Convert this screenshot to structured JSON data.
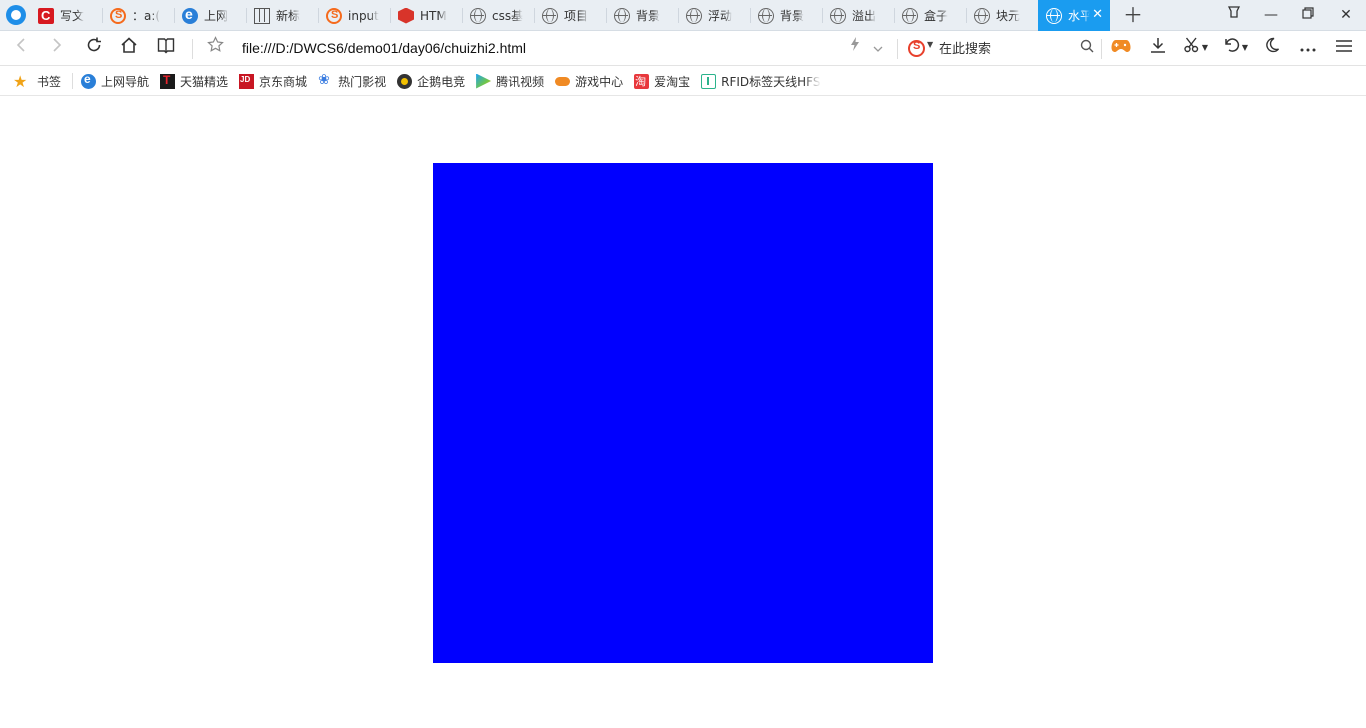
{
  "tabs": [
    {
      "label": "写文",
      "icon": "csdn-icon"
    },
    {
      "label": "：a:(",
      "icon": "sogou-icon"
    },
    {
      "label": "上网",
      "icon": "ie-icon"
    },
    {
      "label": "新标",
      "icon": "grid-icon"
    },
    {
      "label": "input",
      "icon": "sogou-icon"
    },
    {
      "label": "HTM",
      "icon": "html5-icon"
    },
    {
      "label": "css基",
      "icon": "globe-icon"
    },
    {
      "label": "项目",
      "icon": "globe-icon"
    },
    {
      "label": "背景",
      "icon": "globe-icon"
    },
    {
      "label": "浮动",
      "icon": "globe-icon"
    },
    {
      "label": "背景",
      "icon": "globe-icon"
    },
    {
      "label": "溢出",
      "icon": "globe-icon"
    },
    {
      "label": "盒子",
      "icon": "globe-icon"
    },
    {
      "label": "块元",
      "icon": "globe-icon"
    },
    {
      "label": "水平",
      "icon": "globe-icon",
      "active": true
    }
  ],
  "address": {
    "url": "file:///D:/DWCS6/demo01/day06/chuizhi2.html"
  },
  "search": {
    "placeholder": "在此搜索"
  },
  "bookmarks": {
    "folder_label": "书签",
    "items": [
      {
        "label": "上网导航",
        "icon": "ie-icon"
      },
      {
        "label": "天猫精选",
        "icon": "tmall-icon"
      },
      {
        "label": "京东商城",
        "icon": "jd-icon"
      },
      {
        "label": "热门影视",
        "icon": "paw-icon"
      },
      {
        "label": "企鹅电竞",
        "icon": "esports-icon"
      },
      {
        "label": "腾讯视频",
        "icon": "tencent-video-icon"
      },
      {
        "label": "游戏中心",
        "icon": "gamepad-icon"
      },
      {
        "label": "爱淘宝",
        "icon": "taobao-icon"
      },
      {
        "label": "RFID标签天线HFS",
        "icon": "book-icon"
      }
    ]
  },
  "content": {
    "box_color": "#0000ff"
  },
  "colors": {
    "active_tab": "#1a9cf0",
    "tabbar_bg": "#e9eef3"
  }
}
